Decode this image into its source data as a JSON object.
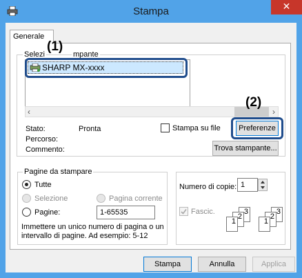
{
  "window": {
    "title": "Stampa",
    "close_glyph": "✕",
    "icon": "printer-icon"
  },
  "tabs": [
    {
      "label": "Generale"
    }
  ],
  "printer_group": {
    "legend_a": "Selezi",
    "legend_b": "mpante",
    "selected_printer": "SHARP MX-xxxx"
  },
  "callouts": {
    "c1": "(1)",
    "c2": "(2)"
  },
  "status": {
    "stato_label": "Stato:",
    "stato_value": "Pronta",
    "percorso_label": "Percorso:",
    "commento_label": "Commento:",
    "print_to_file": "Stampa su file",
    "preferences_button": "Preferenze",
    "find_printer_button": "Trova stampante..."
  },
  "page_range": {
    "legend": "Pagine da stampare",
    "all": "Tutte",
    "selection": "Selezione",
    "current_page": "Pagina corrente",
    "pages": "Pagine:",
    "pages_value": "1-65535",
    "help_line1": "Immettere un unico numero di pagina o un",
    "help_line2": "intervallo di pagine. Ad esempio: 5-12"
  },
  "copies": {
    "label": "Numero di copie:",
    "value": "1",
    "collate": "Fascic.",
    "collate_checked": true,
    "sets": [
      {
        "p1": "1",
        "p2": "2",
        "p3": "3"
      },
      {
        "p1": "1",
        "p2": "2",
        "p3": "3"
      }
    ]
  },
  "buttons": {
    "print": "Stampa",
    "cancel": "Annulla",
    "apply": "Applica"
  },
  "colors": {
    "titlebar": "#51a3e8",
    "close": "#c7362a",
    "highlight": "#1f4c8c",
    "selection": "#cce8ff"
  }
}
